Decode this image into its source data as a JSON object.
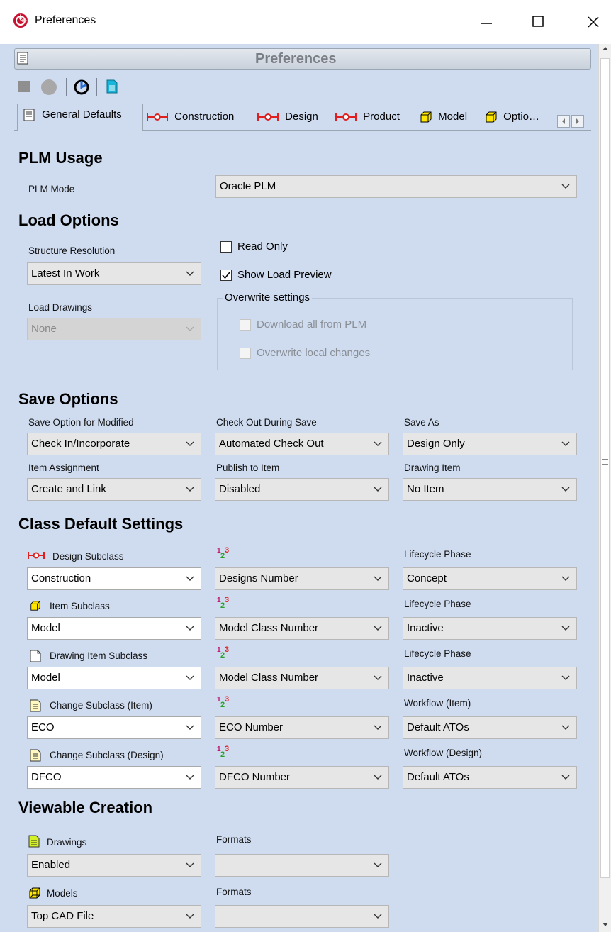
{
  "window": {
    "title": "Preferences"
  },
  "panel": {
    "header_title": "Preferences"
  },
  "tabs": [
    {
      "label": "General Defaults",
      "icon": "list-icon"
    },
    {
      "label": "Construction",
      "icon": "part-red-icon"
    },
    {
      "label": "Design",
      "icon": "part-red-icon"
    },
    {
      "label": "Product",
      "icon": "part-red-icon"
    },
    {
      "label": "Model",
      "icon": "cube-yellow-icon"
    },
    {
      "label": "Optio…",
      "icon": "cube-yellow-icon"
    }
  ],
  "plm_usage": {
    "heading": "PLM Usage",
    "mode_label": "PLM Mode",
    "mode_value": "Oracle PLM"
  },
  "load_options": {
    "heading": "Load Options",
    "structure_resolution_label": "Structure Resolution",
    "structure_resolution_value": "Latest In Work",
    "load_drawings_label": "Load Drawings",
    "load_drawings_value": "None",
    "read_only_label": "Read Only",
    "read_only_checked": false,
    "show_load_preview_label": "Show Load Preview",
    "show_load_preview_checked": true,
    "overwrite_group_label": "Overwrite settings",
    "download_all_label": "Download all from PLM",
    "overwrite_local_label": "Overwrite local changes"
  },
  "save_options": {
    "heading": "Save Options",
    "save_option_modified_label": "Save Option for Modified",
    "save_option_modified_value": "Check In/Incorporate",
    "check_out_label": "Check Out During Save",
    "check_out_value": "Automated Check Out",
    "save_as_label": "Save As",
    "save_as_value": "Design Only",
    "item_assignment_label": "Item Assignment",
    "item_assignment_value": "Create and Link",
    "publish_label": "Publish to Item",
    "publish_value": "Disabled",
    "drawing_item_label": "Drawing Item",
    "drawing_item_value": "No Item"
  },
  "class_defaults": {
    "heading": "Class Default Settings",
    "numbering_glyph": "1 2 3",
    "rows": [
      {
        "label": "Design Subclass",
        "icon": "part-red-icon",
        "value": "Construction",
        "number": "Designs Number",
        "right_label": "Lifecycle Phase",
        "right_value": "Concept"
      },
      {
        "label": "Item Subclass",
        "icon": "cube-yellow-icon",
        "value": "Model",
        "number": "Model Class Number",
        "right_label": "Lifecycle Phase",
        "right_value": "Inactive"
      },
      {
        "label": "Drawing Item Subclass",
        "icon": "page-icon",
        "value": "Model",
        "number": "Model Class Number",
        "right_label": "Lifecycle Phase",
        "right_value": "Inactive"
      },
      {
        "label": "Change Subclass (Item)",
        "icon": "change-doc-icon",
        "value": "ECO",
        "number": "ECO Number",
        "right_label": "Workflow (Item)",
        "right_value": "Default ATOs"
      },
      {
        "label": "Change Subclass (Design)",
        "icon": "change-doc-icon",
        "value": "DFCO",
        "number": "DFCO Number",
        "right_label": "Workflow (Design)",
        "right_value": "Default ATOs"
      }
    ]
  },
  "viewable_creation": {
    "heading": "Viewable Creation",
    "drawings_label": "Drawings",
    "drawings_value": "Enabled",
    "drawings_formats_label": "Formats",
    "drawings_formats_value": "",
    "models_label": "Models",
    "models_value": "Top CAD File",
    "models_formats_label": "Formats",
    "models_formats_value": ""
  },
  "colors": {
    "panel_bg": "#cfdcf0",
    "accent_red": "#e02020",
    "dropdown_bg": "#e6e6e6"
  }
}
